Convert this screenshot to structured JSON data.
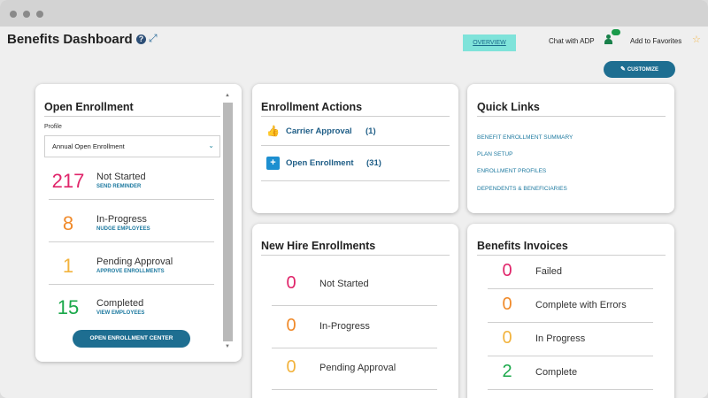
{
  "colors": {
    "accent": "#1e6e91",
    "red": "#e0256a",
    "orange": "#f08a2a",
    "yellow": "#f2b33d",
    "green": "#1aa84a",
    "link": "#1e7aa0"
  },
  "header": {
    "title": "Benefits Dashboard",
    "help_icon_glyph": "?",
    "expand_icon_glyph": "⤢",
    "overview_tab": "OVERVIEW",
    "chat_label": "Chat with ADP",
    "favorites_label": "Add to Favorites",
    "star_glyph": "☆",
    "customize_label": "CUSTOMIZE",
    "pencil_glyph": "✎"
  },
  "open_enrollment": {
    "title": "Open Enrollment",
    "profile_label": "Profile",
    "profile_value": "Annual Open Enrollment",
    "chevron_glyph": "⌄",
    "stats": [
      {
        "value": "217",
        "label": "Not Started",
        "link": "SEND REMINDER",
        "color": "#e0256a"
      },
      {
        "value": "8",
        "label": "In-Progress",
        "link": "NUDGE EMPLOYEES",
        "color": "#f08a2a"
      },
      {
        "value": "1",
        "label": "Pending Approval",
        "link": "APPROVE ENROLLMENTS",
        "color": "#f2b33d"
      },
      {
        "value": "15",
        "label": "Completed",
        "link": "VIEW EMPLOYEES",
        "color": "#1aa84a"
      }
    ],
    "center_button": "OPEN ENROLLMENT CENTER",
    "scroll_up_glyph": "▲",
    "scroll_down_glyph": "▼"
  },
  "enrollment_actions": {
    "title": "Enrollment Actions",
    "items": [
      {
        "label": "Carrier Approval",
        "count": "(1)",
        "icon": "thumbs-up-icon",
        "glyph": "👍"
      },
      {
        "label": "Open Enrollment",
        "count": "(31)",
        "icon": "medical-case-icon",
        "glyph": "+"
      }
    ]
  },
  "quick_links": {
    "title": "Quick Links",
    "links": [
      "BENEFIT ENROLLMENT SUMMARY",
      "PLAN SETUP",
      "ENROLLMENT PROFILES",
      "DEPENDENTS & BENEFICIARIES"
    ]
  },
  "new_hire": {
    "title": "New Hire Enrollments",
    "rows": [
      {
        "value": "0",
        "label": "Not Started",
        "color": "#e0256a"
      },
      {
        "value": "0",
        "label": "In-Progress",
        "color": "#f08a2a"
      },
      {
        "value": "0",
        "label": "Pending Approval",
        "color": "#f2b33d"
      }
    ]
  },
  "invoices": {
    "title": "Benefits Invoices",
    "rows": [
      {
        "value": "0",
        "label": "Failed",
        "color": "#e0256a"
      },
      {
        "value": "0",
        "label": "Complete with Errors",
        "color": "#f08a2a"
      },
      {
        "value": "0",
        "label": "In Progress",
        "color": "#f2b33d"
      },
      {
        "value": "2",
        "label": "Complete",
        "color": "#1aa84a"
      }
    ]
  }
}
